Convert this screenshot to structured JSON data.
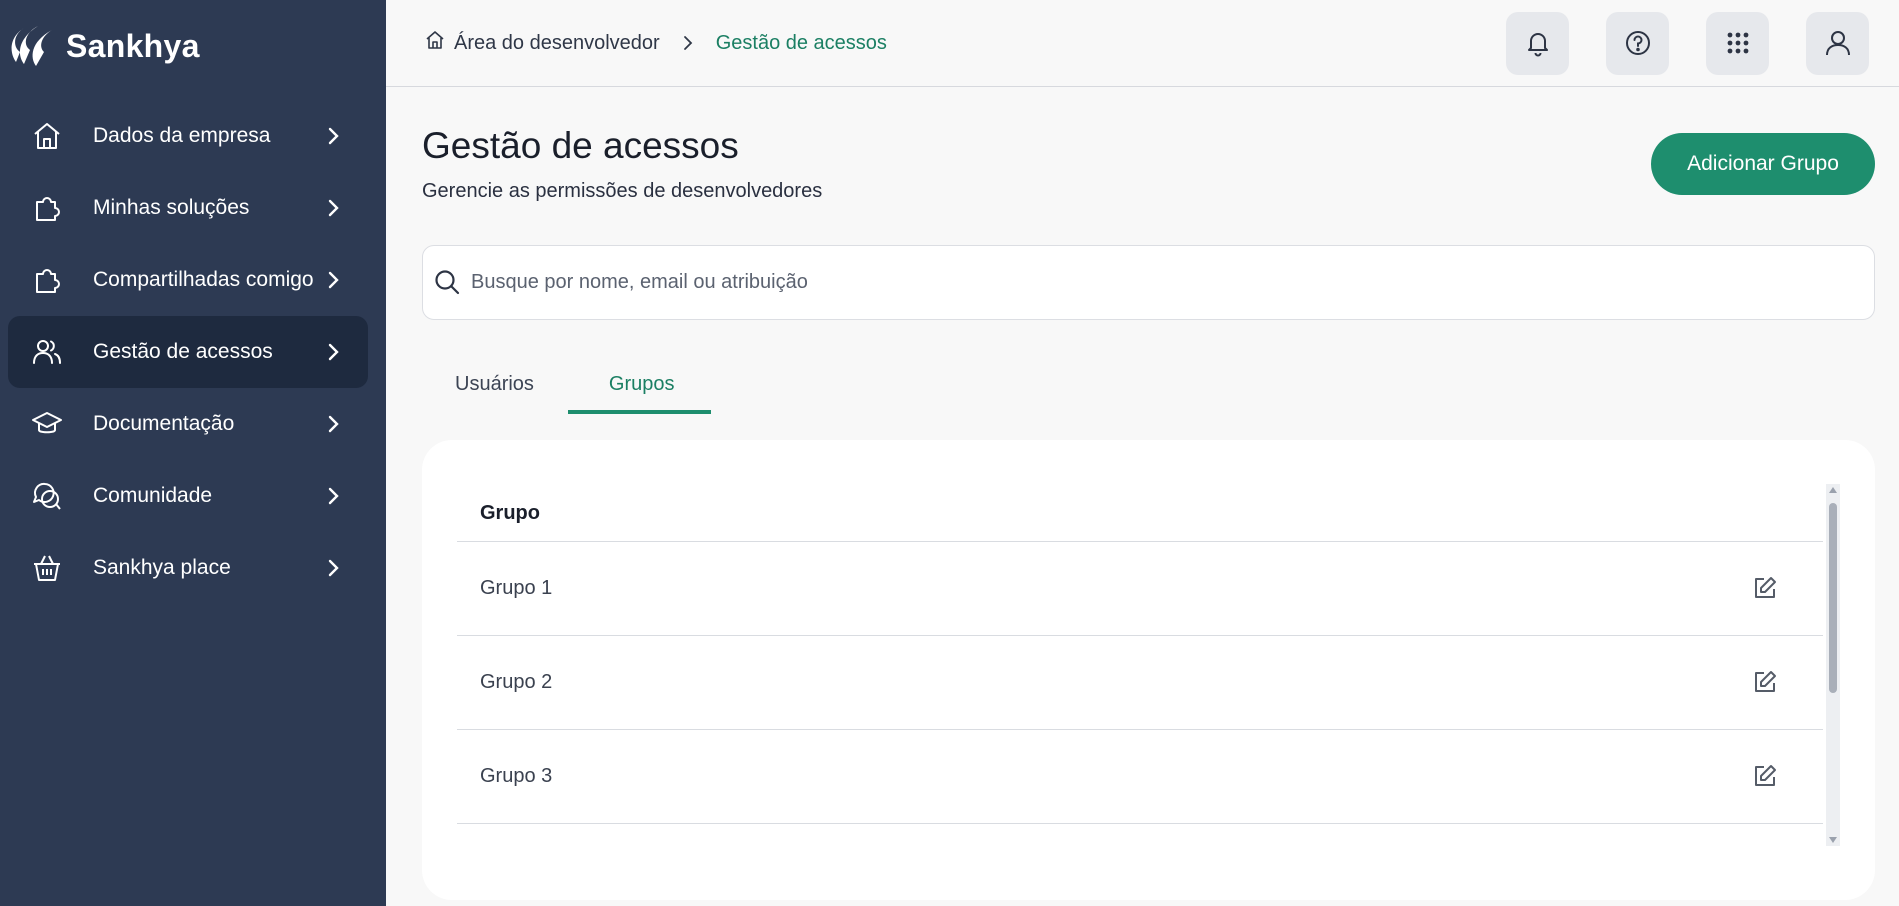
{
  "brand": {
    "name": "Sankhya"
  },
  "sidebar": {
    "items": [
      {
        "label": "Dados da empresa",
        "icon": "home-icon"
      },
      {
        "label": "Minhas soluções",
        "icon": "puzzle-icon"
      },
      {
        "label": "Compartilhadas comigo",
        "icon": "puzzle-icon"
      },
      {
        "label": "Gestão de acessos",
        "icon": "users-icon",
        "active": true
      },
      {
        "label": "Documentação",
        "icon": "graduation-cap-icon"
      },
      {
        "label": "Comunidade",
        "icon": "chat-bubbles-icon"
      },
      {
        "label": "Sankhya place",
        "icon": "basket-icon"
      }
    ]
  },
  "breadcrumb": {
    "parent": "Área do desenvolvedor",
    "current": "Gestão de acessos"
  },
  "top_actions": [
    "bell-icon",
    "help-icon",
    "apps-grid-icon",
    "user-icon"
  ],
  "page": {
    "title": "Gestão de acessos",
    "subtitle": "Gerencie as permissões de desenvolvedores",
    "add_button": "Adicionar Grupo"
  },
  "search": {
    "placeholder": "Busque por nome, email ou atribuição",
    "value": ""
  },
  "tabs": [
    {
      "label": "Usuários",
      "active": false
    },
    {
      "label": "Grupos",
      "active": true
    }
  ],
  "table": {
    "column": "Grupo",
    "rows": [
      {
        "name": "Grupo 1"
      },
      {
        "name": "Grupo 2"
      },
      {
        "name": "Grupo 3"
      }
    ]
  },
  "colors": {
    "sidebar_bg": "#2d3a53",
    "accent": "#1e8e6e",
    "accent_text": "#1b7f63"
  }
}
